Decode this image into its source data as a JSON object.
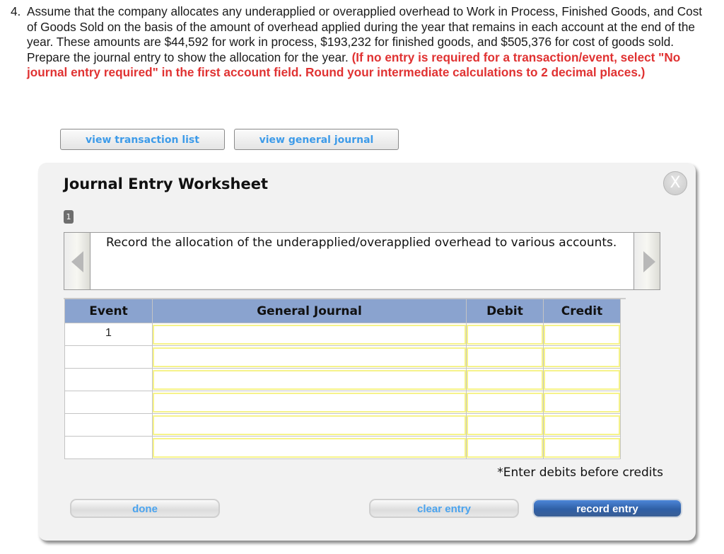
{
  "question": {
    "number": "4.",
    "text": "Assume that the company allocates any underapplied or overapplied overhead to Work in Process, Finished Goods, and Cost of Goods Sold on the basis of the amount of overhead applied during the year that remains in each account at the end of the year. These amounts are $44,592 for work in process, $193,232 for finished goods, and $505,376 for cost of goods sold. Prepare the journal entry to show the allocation for the year.",
    "instruction": "(If no entry is required for a transaction/event, select \"No journal entry required\" in the first account field. Round your intermediate calculations to 2 decimal places.)"
  },
  "toolbar": {
    "view_transaction_list": "view transaction list",
    "view_general_journal": "view general journal"
  },
  "worksheet": {
    "title": "Journal Entry Worksheet",
    "close_icon": "close-icon",
    "close_glyph": "X",
    "page_badge": "1",
    "instruction": "Record the allocation of the underapplied/overapplied overhead to various accounts.",
    "columns": [
      "Event",
      "General Journal",
      "Debit",
      "Credit"
    ],
    "rows": [
      {
        "event": "1",
        "account": "",
        "debit": "",
        "credit": ""
      },
      {
        "event": "",
        "account": "",
        "debit": "",
        "credit": ""
      },
      {
        "event": "",
        "account": "",
        "debit": "",
        "credit": ""
      },
      {
        "event": "",
        "account": "",
        "debit": "",
        "credit": ""
      },
      {
        "event": "",
        "account": "",
        "debit": "",
        "credit": ""
      },
      {
        "event": "",
        "account": "",
        "debit": "",
        "credit": ""
      }
    ],
    "hint": "*Enter debits before credits",
    "buttons": {
      "done": "done",
      "clear_entry": "clear entry",
      "record_entry": "record entry"
    }
  },
  "colors": {
    "instruction_red": "#e03232",
    "link_blue": "#3d9be9",
    "header_blue": "#8aa3cf",
    "field_yellow": "#f6f38a",
    "record_button": "#2f5fa6"
  }
}
